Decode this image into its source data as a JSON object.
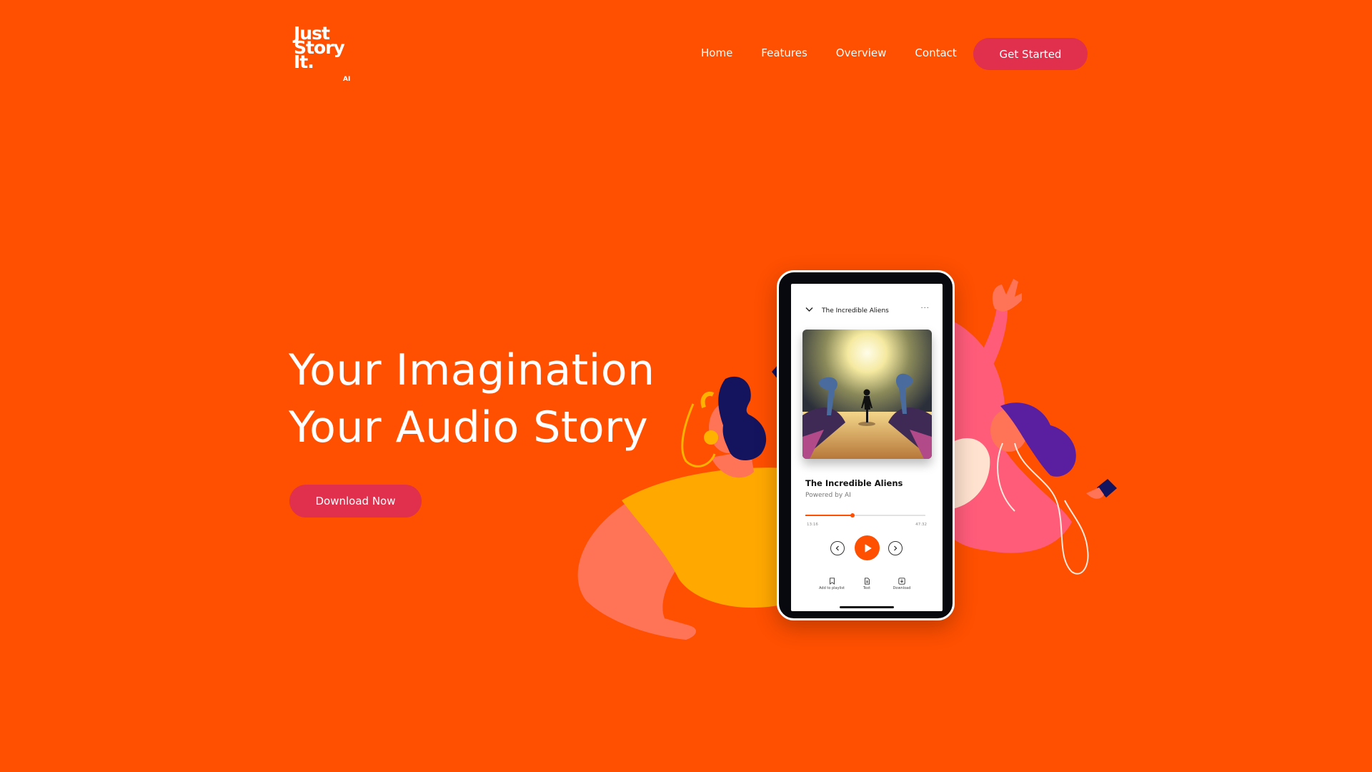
{
  "brand": {
    "logo_lines": [
      "Just",
      "Story",
      "It."
    ],
    "logo_suffix": "AI"
  },
  "nav": {
    "items": [
      {
        "label": "Home"
      },
      {
        "label": "Features"
      },
      {
        "label": "Overview"
      },
      {
        "label": "Contact"
      }
    ],
    "cta_label": "Get Started"
  },
  "hero": {
    "title_line1": "Your Imagination",
    "title_line2": "Your Audio Story",
    "cta_label": "Download Now"
  },
  "player": {
    "header_title": "The Incredible Aliens",
    "track_title": "The Incredible Aliens",
    "subtitle": "Powered by AI",
    "time_elapsed": "13:16",
    "time_total": "47:32",
    "progress": 0.39,
    "actions": [
      {
        "label": "Add to playlist",
        "icon": "bookmark-icon"
      },
      {
        "label": "Text",
        "icon": "document-icon"
      },
      {
        "label": "Download",
        "icon": "download-icon"
      }
    ]
  },
  "colors": {
    "background": "#FF4F00",
    "button": "#E0304E",
    "accent": "#FF4F00"
  }
}
